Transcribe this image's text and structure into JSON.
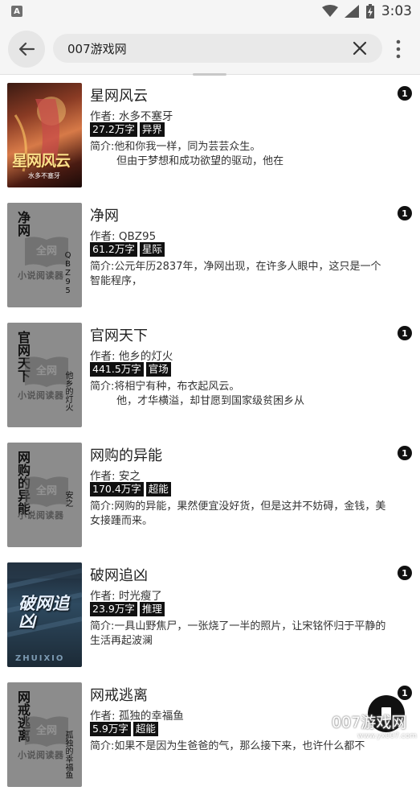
{
  "status_bar": {
    "time": "3:03",
    "notification_letter": "A"
  },
  "toolbar": {
    "search_query": "007游戏网"
  },
  "books": [
    {
      "title": "星网风云",
      "author": "作者: 水多不塞牙",
      "word_count": "27.2万字",
      "genre": "异界",
      "intro": "简介:他和你我一样，同为芸芸众生。\n        但由于梦想和成功欲望的驱动，他在",
      "badge": "1",
      "cover_style": "art",
      "cover_title": "星网风云",
      "cover_author": "水多不塞牙"
    },
    {
      "title": "净网",
      "author": "作者: QBZ95",
      "word_count": "61.2万字",
      "genre": "星际",
      "intro": "简介:公元年历2837年，净网出现，在许多人眼中，这只是一个智能程序，",
      "badge": "1",
      "cover_style": "default",
      "cover_title": "净网",
      "cover_author": "QBZ95"
    },
    {
      "title": "官网天下",
      "author": "作者: 他乡的灯火",
      "word_count": "441.5万字",
      "genre": "官场",
      "intro": "简介:将相宁有种，布衣起风云。\n        他，才华横溢，却甘愿到国家级贫困乡从",
      "badge": "1",
      "cover_style": "default",
      "cover_title": "官网天下",
      "cover_author": "他乡的灯火"
    },
    {
      "title": "网购的异能",
      "author": "作者: 安之",
      "word_count": "170.4万字",
      "genre": "超能",
      "intro": "简介:网购的异能，果然便宜没好货，但是这并不妨碍，金钱，美女接踵而来。",
      "badge": "1",
      "cover_style": "default",
      "cover_title": "网购的异能",
      "cover_author": "安之"
    },
    {
      "title": "破网追凶",
      "author": "作者: 时光瘦了",
      "word_count": "23.9万字",
      "genre": "推理",
      "intro": "简介:一具山野焦尸，一张烧了一半的照片，让宋铭怀归于平静的生活再起波澜",
      "badge": "1",
      "cover_style": "dark",
      "cover_title": "破网追凶",
      "cover_author": "ZHUIXIO"
    },
    {
      "title": "网戒逃离",
      "author": "作者: 孤独的幸福鱼",
      "word_count": "5.9万字",
      "genre": "超能",
      "intro": "简介:如果不是因为生爸爸的气，那么接下来，也许什么都不",
      "badge": "1",
      "cover_style": "default",
      "cover_title": "网戒逃离",
      "cover_author": "孤独的幸福鱼"
    }
  ],
  "cover_brand": "小说阅读器",
  "cover_logo": "全网",
  "watermark": {
    "text": "007游戏网",
    "url": "www.yx007.com"
  },
  "colors": {
    "tag_bg": "#111111",
    "badge_bg": "#111111",
    "cover_default_bg": "#8c8c8c"
  }
}
